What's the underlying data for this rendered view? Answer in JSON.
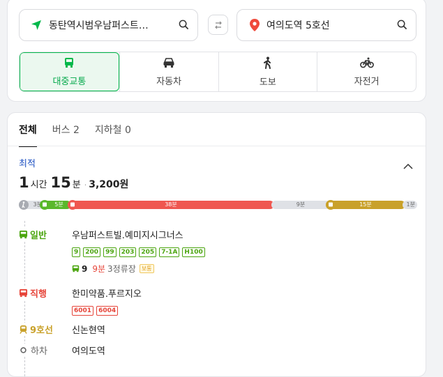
{
  "search": {
    "origin": "동탄역시범우남퍼스트…",
    "destination": "여의도역 5호선"
  },
  "modes": [
    {
      "label": "대중교통",
      "icon": "bus-icon",
      "active": true
    },
    {
      "label": "자동차",
      "icon": "car-icon",
      "active": false
    },
    {
      "label": "도보",
      "icon": "walk-icon",
      "active": false
    },
    {
      "label": "자전거",
      "icon": "bicycle-icon",
      "active": false
    }
  ],
  "tabs": [
    "전체",
    "버스 2",
    "지하철 0"
  ],
  "route": {
    "badge": "최적",
    "hours": "1",
    "hours_unit": "시간",
    "minutes": "15",
    "minutes_unit": "분",
    "separator": "·",
    "fare": "3,200원",
    "bar": [
      {
        "type": "walk",
        "label": "3분",
        "color": "#dfe1e6"
      },
      {
        "type": "bus",
        "label": "5분",
        "color": "#5ab82b"
      },
      {
        "type": "bus",
        "label": "38분",
        "color": "#ef5750"
      },
      {
        "type": "walk",
        "label": "9분",
        "color": "#dfe1e6"
      },
      {
        "type": "subway",
        "label": "15분",
        "color": "#c9a12a"
      },
      {
        "type": "walk",
        "label": "1분",
        "color": "#dfe1e6"
      }
    ],
    "steps": [
      {
        "kind": "일반",
        "color": "#4ba50f",
        "icon": "bus-icon",
        "stop": "우남퍼스트빌.예미지시그너스",
        "lines": [
          "9",
          "200",
          "99",
          "203",
          "205",
          "7-1A",
          "H100"
        ],
        "arrival": {
          "line": "9",
          "wait": "9분",
          "stops": "3정류장",
          "tag": "보통"
        }
      },
      {
        "kind": "직행",
        "color": "#e6453a",
        "icon": "bus-icon",
        "stop": "한미약품.푸르지오",
        "lines": [
          "6001",
          "6004"
        ]
      },
      {
        "kind": "9호선",
        "color": "#c9a12a",
        "icon": "subway-icon",
        "stop": "신논현역"
      },
      {
        "kind": "하차",
        "color": "#666666",
        "icon": "dropoff-circle-icon",
        "stop": "여의도역"
      }
    ]
  },
  "colors": {
    "accent": "#03b84b",
    "best": "#1c4fc1"
  }
}
